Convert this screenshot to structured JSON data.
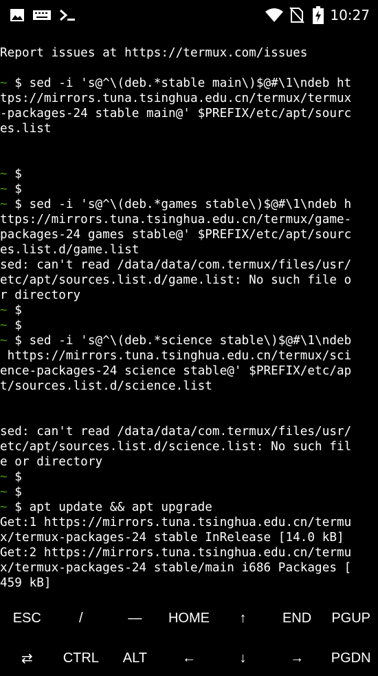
{
  "status_bar": {
    "icons": [
      "image-icon",
      "keyboard-icon",
      "terminal-icon",
      "wifi-icon",
      "no-sim-icon",
      "battery-charging-icon"
    ],
    "time": "10:27"
  },
  "terminal": {
    "prompt_color": "#4e9a06",
    "text_color": "#ffffff",
    "background": "#000000",
    "lines": [
      {
        "prompt": "",
        "text": "Report issues at https://termux.com/issues"
      },
      {
        "prompt": "",
        "text": ""
      },
      {
        "prompt": "~",
        "text": " $ sed -i 's@^\\(deb.*stable main\\)$@#\\1\\ndeb ht"
      },
      {
        "prompt": "",
        "text": "tps://mirrors.tuna.tsinghua.edu.cn/termux/termux"
      },
      {
        "prompt": "",
        "text": "-packages-24 stable main@' $PREFIX/etc/apt/sourc"
      },
      {
        "prompt": "",
        "text": "es.list"
      },
      {
        "prompt": "",
        "text": ""
      },
      {
        "prompt": "",
        "text": ""
      },
      {
        "prompt": "~",
        "text": " $"
      },
      {
        "prompt": "~",
        "text": " $"
      },
      {
        "prompt": "~",
        "text": " $ sed -i 's@^\\(deb.*games stable\\)$@#\\1\\ndeb h"
      },
      {
        "prompt": "",
        "text": "ttps://mirrors.tuna.tsinghua.edu.cn/termux/game-"
      },
      {
        "prompt": "",
        "text": "packages-24 games stable@' $PREFIX/etc/apt/sourc"
      },
      {
        "prompt": "",
        "text": "es.list.d/game.list"
      },
      {
        "prompt": "",
        "text": "sed: can't read /data/data/com.termux/files/usr/"
      },
      {
        "prompt": "",
        "text": "etc/apt/sources.list.d/game.list: No such file o"
      },
      {
        "prompt": "",
        "text": "r directory"
      },
      {
        "prompt": "~",
        "text": " $"
      },
      {
        "prompt": "~",
        "text": " $"
      },
      {
        "prompt": "~",
        "text": " $ sed -i 's@^\\(deb.*science stable\\)$@#\\1\\ndeb"
      },
      {
        "prompt": "",
        "text": " https://mirrors.tuna.tsinghua.edu.cn/termux/sci"
      },
      {
        "prompt": "",
        "text": "ence-packages-24 science stable@' $PREFIX/etc/ap"
      },
      {
        "prompt": "",
        "text": "t/sources.list.d/science.list"
      },
      {
        "prompt": "",
        "text": ""
      },
      {
        "prompt": "",
        "text": ""
      },
      {
        "prompt": "",
        "text": "sed: can't read /data/data/com.termux/files/usr/"
      },
      {
        "prompt": "",
        "text": "etc/apt/sources.list.d/science.list: No such fil"
      },
      {
        "prompt": "",
        "text": "e or directory"
      },
      {
        "prompt": "~",
        "text": " $"
      },
      {
        "prompt": "~",
        "text": " $"
      },
      {
        "prompt": "~",
        "text": " $ apt update && apt upgrade"
      },
      {
        "prompt": "",
        "text": "Get:1 https://mirrors.tuna.tsinghua.edu.cn/termu"
      },
      {
        "prompt": "",
        "text": "x/termux-packages-24 stable InRelease [14.0 kB]"
      },
      {
        "prompt": "",
        "text": "Get:2 https://mirrors.tuna.tsinghua.edu.cn/termu"
      },
      {
        "prompt": "",
        "text": "x/termux-packages-24 stable/main i686 Packages ["
      },
      {
        "prompt": "",
        "text": "459 kB]"
      }
    ]
  },
  "extra_keys": {
    "row1": [
      {
        "name": "esc-key",
        "label": "ESC"
      },
      {
        "name": "slash-key",
        "label": "/"
      },
      {
        "name": "minus-key",
        "label": "—"
      },
      {
        "name": "home-key",
        "label": "HOME"
      },
      {
        "name": "arrow-up-key",
        "label": "↑"
      },
      {
        "name": "end-key",
        "label": "END"
      },
      {
        "name": "pgup-key",
        "label": "PGUP"
      }
    ],
    "row2": [
      {
        "name": "tab-key",
        "label": "⇄"
      },
      {
        "name": "ctrl-key",
        "label": "CTRL"
      },
      {
        "name": "alt-key",
        "label": "ALT"
      },
      {
        "name": "arrow-left-key",
        "label": "←"
      },
      {
        "name": "arrow-down-key",
        "label": "↓"
      },
      {
        "name": "arrow-right-key",
        "label": "→"
      },
      {
        "name": "pgdn-key",
        "label": "PGDN"
      }
    ]
  }
}
